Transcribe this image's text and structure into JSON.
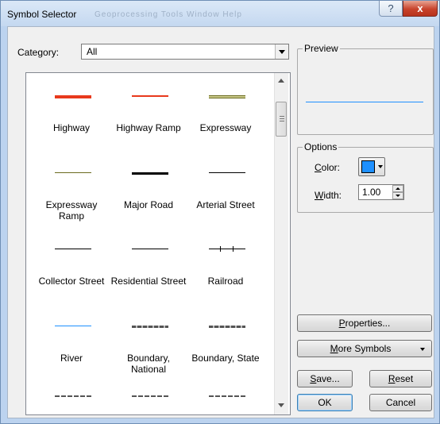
{
  "window": {
    "title": "Symbol Selector",
    "title_ghost": "Geoprocessing  Tools  Window  Help",
    "help_label": "?",
    "close_label": "x"
  },
  "category": {
    "label": "Category:",
    "value": "All"
  },
  "symbols": [
    {
      "label": "Highway",
      "color": "#e8391c"
    },
    {
      "label": "Highway Ramp",
      "color": "#e8391c"
    },
    {
      "label": "Expressway",
      "color": "#6b6b1f"
    },
    {
      "label": "Expressway Ramp",
      "color": "#6b6b1f"
    },
    {
      "label": "Major Road",
      "color": "#000000"
    },
    {
      "label": "Arterial Street",
      "color": "#000000"
    },
    {
      "label": "Collector Street",
      "color": "#000000"
    },
    {
      "label": "Residential Street",
      "color": "#000000"
    },
    {
      "label": "Railroad",
      "color": "#000000"
    },
    {
      "label": "River",
      "color": "#1e90ff"
    },
    {
      "label": "Boundary, National",
      "color": "#555555"
    },
    {
      "label": "Boundary, State",
      "color": "#555555"
    }
  ],
  "preview": {
    "legend": "Preview",
    "line_color": "#1e90ff"
  },
  "options": {
    "legend": "Options",
    "color_label": "Color:",
    "color_value": "#1e90ff",
    "width_label": "Width:",
    "width_value": "1.00"
  },
  "buttons": {
    "properties": "Properties...",
    "more_symbols": "More Symbols",
    "save": "Save...",
    "reset": "Reset",
    "ok": "OK",
    "cancel": "Cancel"
  }
}
